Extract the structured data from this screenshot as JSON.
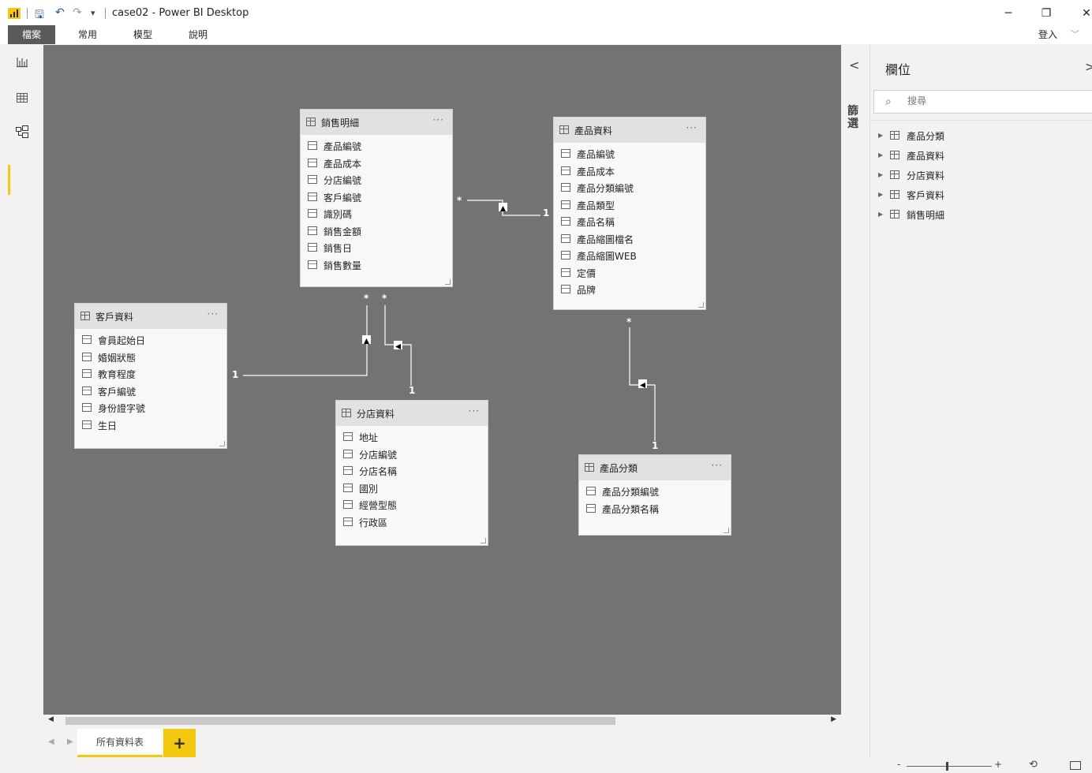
{
  "window": {
    "title": "case02 - Power BI Desktop",
    "minimize_label": "─",
    "restore_label": "❐",
    "close_label": "✕"
  },
  "quick_access": {
    "save_icon": "save-icon",
    "undo_icon": "undo-icon",
    "redo_icon": "redo-icon",
    "customize_label": "▾"
  },
  "menu": {
    "file": "檔案",
    "home": "常用",
    "modeling": "模型",
    "help": "說明",
    "signin": "登入",
    "signin_chevron": "﹀"
  },
  "tables": {
    "sales": {
      "name": "銷售明細",
      "more": "···",
      "fields": [
        "產品編號",
        "產品成本",
        "分店編號",
        "客戶編號",
        "識別碼",
        "銷售金額",
        "銷售日",
        "銷售數量"
      ]
    },
    "product": {
      "name": "產品資料",
      "more": "···",
      "fields": [
        "產品編號",
        "產品成本",
        "產品分類編號",
        "產品類型",
        "產品名稱",
        "產品縮圖檔名",
        "產品縮圖WEB",
        "定價",
        "品牌"
      ]
    },
    "customer": {
      "name": "客戶資料",
      "more": "···",
      "fields": [
        "會員起始日",
        "婚姻狀態",
        "教育程度",
        "客戶編號",
        "身份證字號",
        "生日"
      ]
    },
    "store": {
      "name": "分店資料",
      "more": "···",
      "fields": [
        "地址",
        "分店編號",
        "分店名稱",
        "國別",
        "經營型態",
        "行政區"
      ]
    },
    "category": {
      "name": "產品分類",
      "more": "···",
      "fields": [
        "產品分類編號",
        "產品分類名稱"
      ]
    }
  },
  "relationships": {
    "many": "*",
    "one": "1"
  },
  "tabs": {
    "all_tables": "所有資料表",
    "add": "+",
    "prev": "◀",
    "next": "▶"
  },
  "right_strip": {
    "collapse": "<",
    "label": "篩選"
  },
  "fields_pane": {
    "title": "欄位",
    "close": ">",
    "search_placeholder": "搜尋",
    "items": [
      "產品分類",
      "產品資料",
      "分店資料",
      "客戶資料",
      "銷售明細"
    ]
  },
  "zoom": {
    "minus": "-",
    "plus": "+",
    "reset": "⟲"
  },
  "scroll": {
    "left": "◀",
    "right": "▶"
  }
}
